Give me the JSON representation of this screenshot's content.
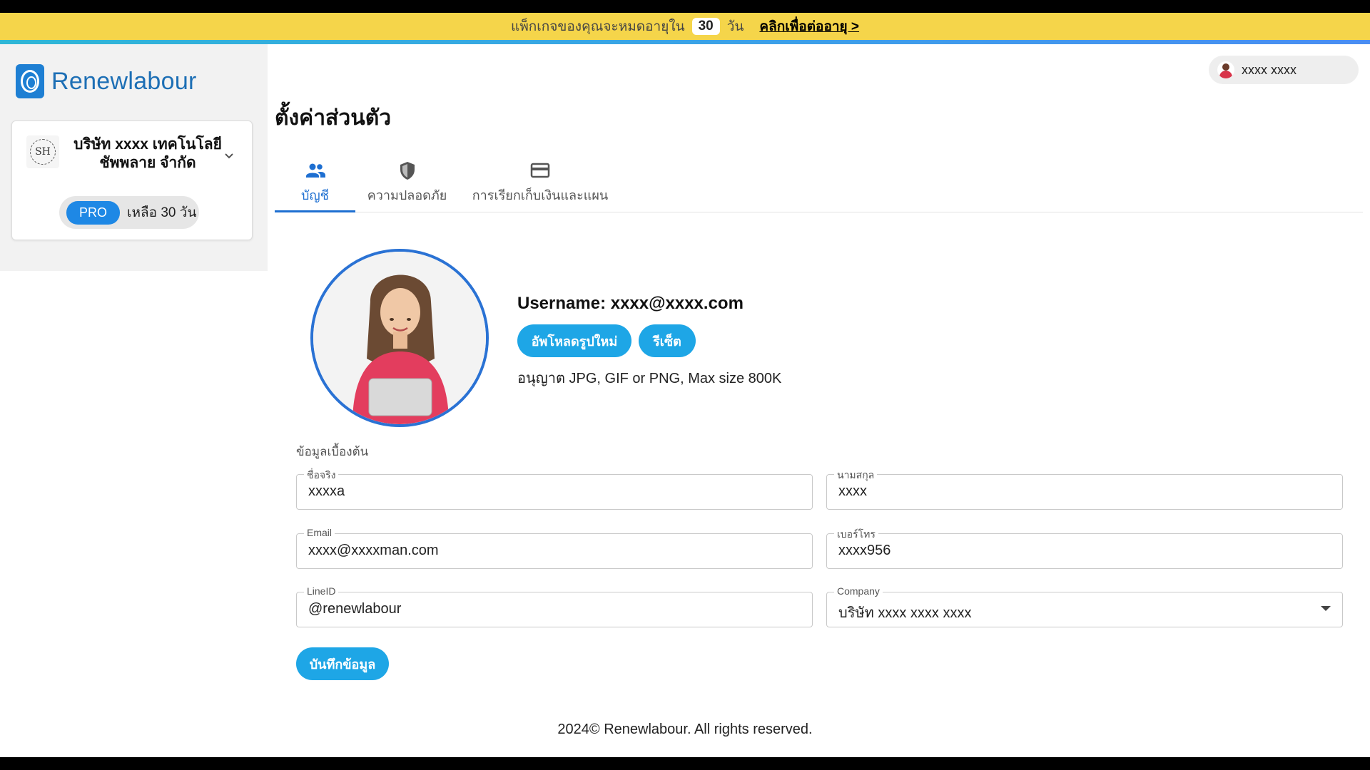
{
  "banner": {
    "prefix": "แพ็กเกจของคุณจะหมดอายุใน",
    "days": "30",
    "suffix": "วัน",
    "link": "คลิกเพื่อต่ออายุ >"
  },
  "app": {
    "name": "Renewlabour"
  },
  "company": {
    "avatar_initials": "SH",
    "name": "บริษัท xxxx เทคโนโลยี ชัพพลาย จำกัด",
    "plan": "PRO",
    "remaining": "เหลือ 30 วัน"
  },
  "user_chip": {
    "name": "xxxx xxxx"
  },
  "page": {
    "title": "ตั้งค่าส่วนตัว"
  },
  "tabs": [
    {
      "label": "บัญชี",
      "icon": "users-icon",
      "active": true
    },
    {
      "label": "ความปลอดภัย",
      "icon": "shield-icon",
      "active": false
    },
    {
      "label": "การเรียกเก็บเงินและแผน",
      "icon": "credit-card-icon",
      "active": false
    }
  ],
  "profile": {
    "username": "Username: xxxx@xxxx.com",
    "upload_label": "อัพโหลดรูปใหม่",
    "reset_label": "รีเซ็ต",
    "hint": "อนุญาต JPG, GIF or PNG, Max size 800K"
  },
  "form": {
    "section_label": "ข้อมูลเบื้องต้น",
    "first_name": {
      "label": "ชื่อจริง",
      "value": "xxxxa"
    },
    "last_name": {
      "label": "นามสกุล",
      "value": "xxxx"
    },
    "email": {
      "label": "Email",
      "value": "xxxx@xxxxman.com"
    },
    "phone": {
      "label": "เบอร์โทร",
      "value": "xxxx956"
    },
    "line_id": {
      "label": "LineID",
      "value": "@renewlabour"
    },
    "company": {
      "label": "Company",
      "value": "บริษัท xxxx xxxx xxxx"
    },
    "save_label": "บันทึกข้อมูล"
  },
  "footer": {
    "text": "2024© Renewlabour. All rights reserved."
  },
  "colors": {
    "banner_bg": "#f5d54a",
    "accent": "#1ea6e6",
    "tab_active": "#1e6fd1",
    "brand": "#1d6fb5"
  }
}
